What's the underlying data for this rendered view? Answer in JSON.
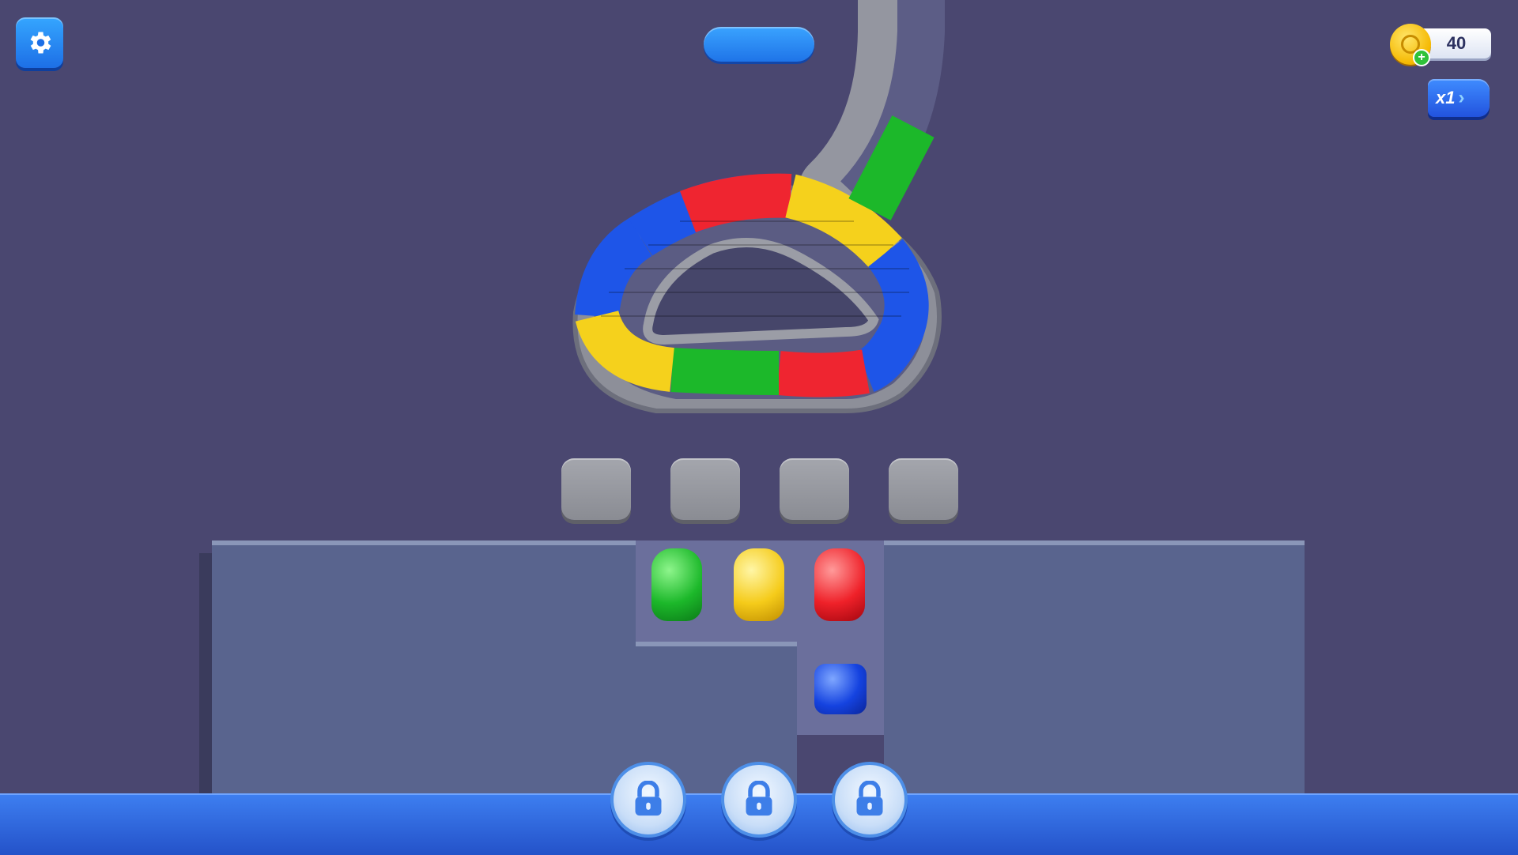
{
  "hud": {
    "coins": "40",
    "speed_label": "x1",
    "speed_chevron": "›",
    "coin_plus": "+"
  },
  "icons": {
    "settings": "gear-icon",
    "coin": "coin-icon",
    "lock": "lock-icon"
  },
  "colors": {
    "background": "#4a4770",
    "accent_blue": "#1d6fe6",
    "green": "#1cb82a",
    "yellow": "#f5cb1a",
    "red": "#ef2129",
    "blue": "#1543e0"
  },
  "board": {
    "pieces": [
      "green",
      "yellow",
      "red",
      "blue"
    ],
    "empty_slots": 4,
    "locked_slots": 3
  }
}
